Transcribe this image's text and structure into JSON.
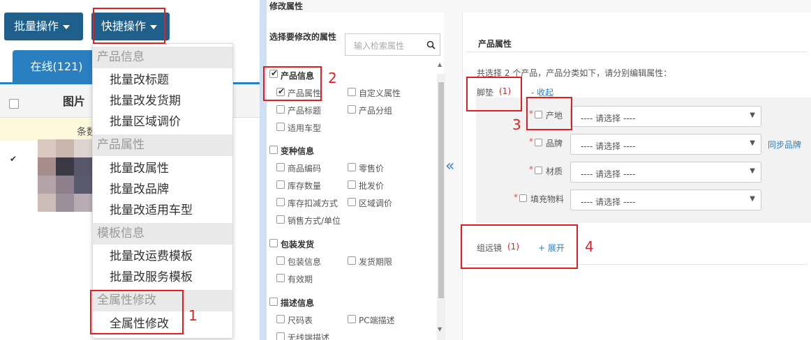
{
  "left": {
    "batch_button": "批量操作",
    "quick_button": "快捷操作",
    "tab_online": "在线(121)",
    "column_image": "图片",
    "row_text": "条数"
  },
  "menu": {
    "groups": [
      {
        "title": "产品信息",
        "items": [
          "批量改标题",
          "批量改发货期",
          "批量区域调价"
        ]
      },
      {
        "title": "产品属性",
        "items": [
          "批量改属性",
          "批量改品牌",
          "批量改适用车型"
        ]
      },
      {
        "title": "模板信息",
        "items": [
          "批量改运费模板",
          "批量改服务模板"
        ]
      },
      {
        "title": "全属性修改",
        "items": [
          "全属性修改"
        ]
      }
    ]
  },
  "dialog": {
    "title": "修改属性",
    "select_label": "选择要修改的属性",
    "search_placeholder": "输入检索属性",
    "sections": [
      {
        "title": "产品信息",
        "checked": true,
        "options": [
          "产品属性",
          "自定义属性",
          "产品标题",
          "产品分组",
          "适用车型"
        ],
        "checked_options": [
          "产品属性"
        ]
      },
      {
        "title": "变种信息",
        "checked": false,
        "options": [
          "商品编码",
          "零售价",
          "库存数量",
          "批发价",
          "库存扣减方式",
          "区域调价",
          "销售方式/单位"
        ],
        "checked_options": []
      },
      {
        "title": "包装发货",
        "checked": false,
        "options": [
          "包装信息",
          "发货期限",
          "有效期"
        ],
        "checked_options": []
      },
      {
        "title": "描述信息",
        "checked": false,
        "options": [
          "尺码表",
          "PC端描述",
          "无线端描述"
        ],
        "checked_options": []
      }
    ],
    "move_arrow": "«"
  },
  "right": {
    "heading": "产品属性",
    "summary": "共选择 2 个产品，产品分类如下，请分别编辑属性：",
    "cat1_name": "脚垫",
    "cat1_count": "(1)",
    "cat1_toggle": "- 收起",
    "fields": [
      {
        "label": "产地",
        "value": "---- 请选择 ----"
      },
      {
        "label": "品牌",
        "value": "---- 请选择 ----"
      },
      {
        "label": "材质",
        "value": "---- 请选择 ----"
      },
      {
        "label": "填充物料",
        "value": "---- 请选择 ----"
      }
    ],
    "sync_brand": "同步品牌",
    "cat2_name": "组远镜",
    "cat2_count": "(1)",
    "cat2_toggle": "+ 展开"
  },
  "callouts": [
    "1",
    "2",
    "3",
    "4"
  ],
  "colors": {
    "accent": "#2a7fc0",
    "dark_button": "#1f5f8c",
    "highlight": "#e02020"
  }
}
